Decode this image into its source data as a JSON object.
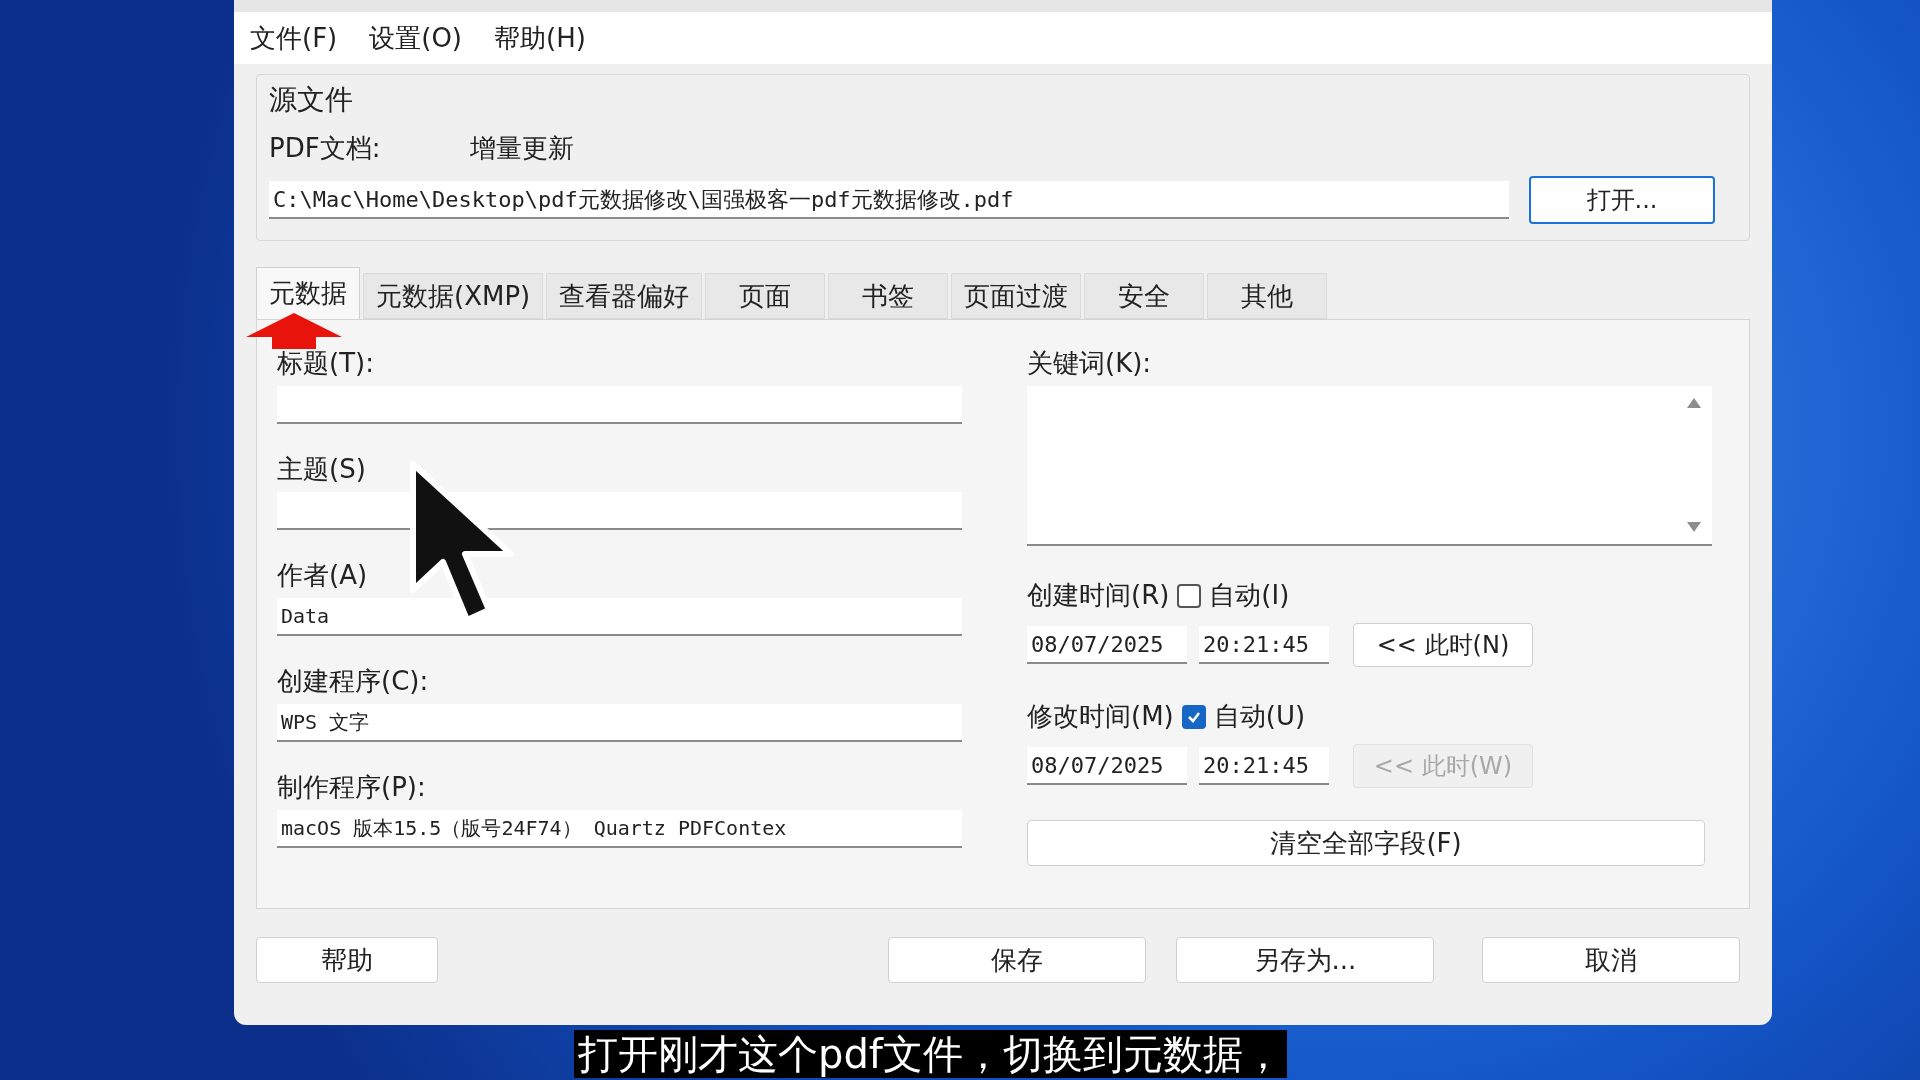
{
  "menu": [
    "文件(F)",
    "设置(O)",
    "帮助(H)"
  ],
  "source": {
    "title": "源文件",
    "pdf_label": "PDF文档:",
    "pdf_mode": "增量更新",
    "path": "C:\\Mac\\Home\\Desktop\\pdf元数据修改\\国强极客一pdf元数据修改.pdf",
    "open_button": "打开..."
  },
  "tabs": [
    {
      "label": "元数据",
      "selected": true
    },
    {
      "label": "元数据(XMP)",
      "selected": false
    },
    {
      "label": "查看器偏好",
      "selected": false
    },
    {
      "label": "页面",
      "selected": false
    },
    {
      "label": "书签",
      "selected": false
    },
    {
      "label": "页面过渡",
      "selected": false
    },
    {
      "label": "安全",
      "selected": false
    },
    {
      "label": "其他",
      "selected": false
    }
  ],
  "fields": [
    {
      "label": "标题(T):"
    },
    {
      "label": "主题(S)"
    },
    {
      "label": "作者(A)",
      "value": "Data"
    },
    {
      "label": "创建程序(C):",
      "value": "WPS 文字"
    },
    {
      "label": "制作程序(P):",
      "value": "macOS 版本15.5（版号24F74） Quartz PDFContex"
    }
  ],
  "keywords": {
    "label": "关键词(K):"
  },
  "times": [
    {
      "label": "创建时间(R)",
      "auto_label": "自动(I)",
      "auto_checked": false,
      "date": "08/07/2025",
      "time": "20:21:45",
      "now_button": "<< 此时(N)",
      "now_disabled": false
    },
    {
      "label": "修改时间(M)",
      "auto_label": "自动(U)",
      "auto_checked": true,
      "date": "08/07/2025",
      "time": "20:21:45",
      "now_button": "<< 此时(W)",
      "now_disabled": true
    }
  ],
  "clear_button": "清空全部字段(F)",
  "buttons": [
    "帮助",
    "保存",
    "另存为...",
    "取消"
  ],
  "subtitle": "打开刚才这个pdf文件，切换到元数据，"
}
